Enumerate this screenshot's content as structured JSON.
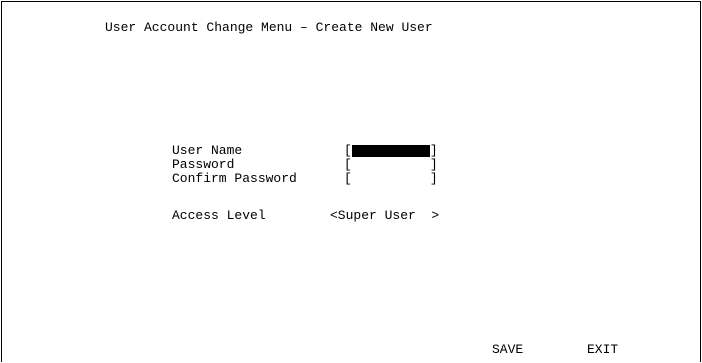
{
  "screen": {
    "title": "User Account Change Menu – Create New User"
  },
  "form": {
    "user_name_label": "User Name",
    "password_label": "Password",
    "confirm_password_label": "Confirm Password",
    "access_level_label": "Access Level",
    "bracket_open": "[",
    "bracket_close": "]",
    "user_name_value": "",
    "password_value": "",
    "confirm_password_value": "",
    "access_level_value": "<Super User  >"
  },
  "footer": {
    "save_label": "SAVE",
    "exit_label": "EXIT"
  },
  "colors": {
    "background": "#ffffff",
    "text": "#000000",
    "active_field": "#000000"
  }
}
